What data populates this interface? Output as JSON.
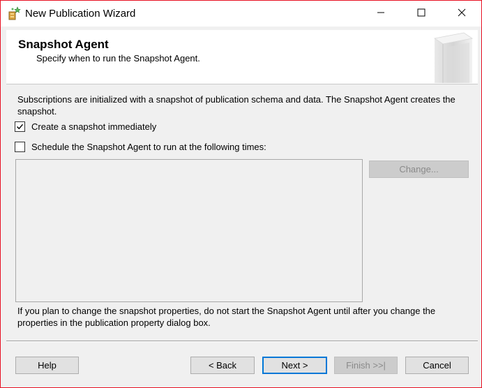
{
  "window": {
    "title": "New Publication Wizard",
    "icon": "publication-wizard-icon",
    "controls": {
      "minimize_icon": "minimize-icon",
      "maximize_icon": "maximize-icon",
      "close_icon": "close-icon"
    },
    "border_color": "#e81123"
  },
  "header": {
    "title": "Snapshot Agent",
    "subtitle": "Specify when to run the Snapshot Agent."
  },
  "body": {
    "intro": "Subscriptions are initialized with a snapshot of publication schema and data. The Snapshot Agent creates the snapshot.",
    "create_snapshot": {
      "label": "Create a snapshot immediately",
      "checked": true
    },
    "schedule_agent": {
      "label": "Schedule the Snapshot Agent to run at the following times:",
      "checked": false
    },
    "schedule_text": "",
    "change_label": "Change...",
    "note": "If you plan to change the snapshot properties, do not start the Snapshot Agent until after you change the properties in the publication property dialog box."
  },
  "footer": {
    "help": "Help",
    "back": "< Back",
    "next": "Next >",
    "finish": "Finish >>|",
    "cancel": "Cancel"
  }
}
